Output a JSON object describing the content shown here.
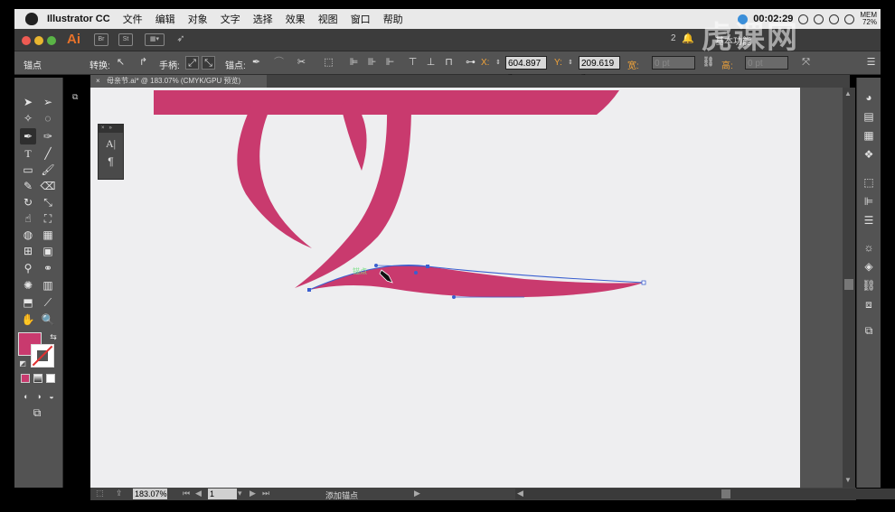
{
  "menubar": {
    "app_name": "Illustrator CC",
    "items": [
      "文件",
      "编辑",
      "对象",
      "文字",
      "选择",
      "效果",
      "视图",
      "窗口",
      "帮助"
    ],
    "time": "00:02:29",
    "mem_label": "MEM",
    "mem_value": "72%"
  },
  "appbar": {
    "logo": "Ai",
    "btn_br": "Br",
    "btn_st": "St",
    "workspace_count": "2",
    "workspace": "基本功能",
    "watermark": "虎课网"
  },
  "control_bar": {
    "mode_label": "锚点",
    "convert_label": "转换:",
    "handles_label": "手柄:",
    "anchor_label": "锚点:",
    "x_label": "X:",
    "x_value": "604.897 p",
    "y_label": "Y:",
    "y_value": "209.619 p",
    "w_label": "宽:",
    "w_value": "0 pt",
    "h_label": "高:",
    "h_value": "0 pt"
  },
  "document": {
    "tab_title": "母亲节.ai* @ 183.07% (CMYK/GPU 预览)",
    "anchor_hint": "锚点"
  },
  "status_bar": {
    "zoom": "183.07%",
    "page": "1",
    "tool_status": "添加锚点"
  },
  "colors": {
    "shape_fill": "#c93a6e",
    "canvas": "#eeeef0",
    "path_blue": "#3a5fd0",
    "smart_guide": "#7ee08a"
  },
  "tool_icons": [
    "selection-icon",
    "direct-selection-icon",
    "magic-wand-icon",
    "lasso-icon",
    "pen-icon",
    "curvature-icon",
    "type-icon",
    "line-icon",
    "rectangle-icon",
    "paintbrush-icon",
    "pencil-icon",
    "eraser-icon",
    "rotate-icon",
    "scale-icon",
    "warp-icon",
    "free-transform-icon",
    "shape-builder-icon",
    "perspective-grid-icon",
    "mesh-icon",
    "gradient-icon",
    "eyedropper-icon",
    "blend-icon",
    "symbol-sprayer-icon",
    "column-graph-icon",
    "artboard-icon",
    "slice-icon",
    "hand-icon",
    "zoom-icon"
  ]
}
